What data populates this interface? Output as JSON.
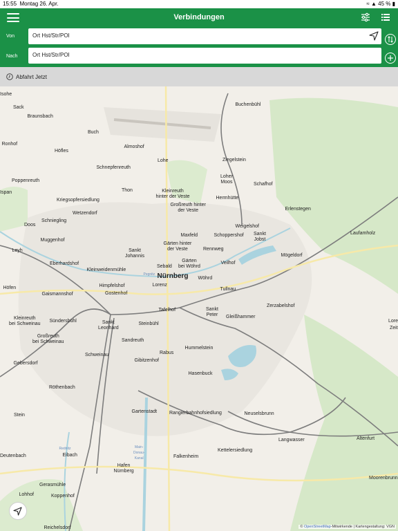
{
  "status_bar": {
    "time": "15:55",
    "date": "Montag 26. Apr.",
    "battery": "45 %"
  },
  "header": {
    "title": "Verbindungen",
    "from_label": "Von",
    "to_label": "Nach",
    "from_placeholder": "Ort Hst/Str/POI",
    "to_placeholder": "Ort Hst/Str/POI"
  },
  "departure": {
    "text": "Abfahrt Jetzt"
  },
  "icons": {
    "menu": "hamburger-icon",
    "filter": "sliders-icon",
    "list": "list-icon",
    "location": "navigation-arrow-icon",
    "swap": "swap-icon",
    "add": "plus-icon",
    "clock": "clock-icon"
  },
  "colors": {
    "header": "#1b9147",
    "map_bg": "#f2efe9",
    "water": "#aad3df",
    "forest": "#d6e8c8"
  },
  "map": {
    "city": "Nürnberg",
    "places": [
      "Buchenbühl",
      "Sack",
      "Braunsbach",
      "Buch",
      "Ronhof",
      "Höfles",
      "Almoshof",
      "Lohe",
      "Ziegelstein",
      "Schnepfenreuth",
      "Poppenreuth",
      "Loher Moos",
      "Schafhof",
      "Kleinreuth hinter der Veste",
      "Thon",
      "Kriegsopfersiedlung",
      "Hermhütte",
      "Großreuth hinter der Veste",
      "Erlenstegen",
      "Wetzendorf",
      "Schniegling",
      "Doos",
      "Weigelshof",
      "Laufamholz",
      "Muggenhof",
      "Maxfeld",
      "Schoppershof",
      "Sankt Jobst",
      "Sankt Johannis",
      "Gärten hinter der Veste",
      "Rennweg",
      "Eberhardshof",
      "Mögeldorf",
      "Gärten bei Wöhrd",
      "Sebald",
      "Veilhof",
      "Kleinweidenmühle",
      "Wöhrd",
      "Himpfelshof",
      "Lorenz",
      "Tullnau",
      "Gaismannshof",
      "Gostenhof",
      "Zerzabelshof",
      "Tafelhof",
      "Sankt Peter",
      "Gleißhammer",
      "Kleinreuth bei Schweinau",
      "Sündersbühl",
      "Sankt Leonhard",
      "Steinbühl",
      "Großreuth bei Schweinau",
      "Sandreuth",
      "Hummelstein",
      "Gebersdorf",
      "Schweinau",
      "Rabus",
      "Gibitzenhof",
      "Hasenbuck",
      "Röthenbach",
      "Stein",
      "Gartenstadt",
      "Rangierbahnhofsiedlung",
      "Neuselsbrunn",
      "Langwasser",
      "Altenfurt",
      "Deutenbach",
      "Eibach",
      "Kettelersiedlung",
      "Falkenheim",
      "Hafen Nürnberg",
      "Moorenbrunn",
      "Gerasmühle",
      "Lohhof",
      "Koppenhof",
      "Reichelsdorf",
      "Höfen",
      "Leyh",
      "Isohe",
      "Ispan",
      "Pegnitz",
      "Rednitz",
      "Main-Donau-Kanal",
      "Lorenzer Reichswald",
      "Zeitlaubenweg"
    ],
    "attribution_prefix": "©",
    "attribution_link": "OpenStreetMap",
    "attribution_rest": "-Mitwirkende | Kartengestaltung: VGN"
  }
}
